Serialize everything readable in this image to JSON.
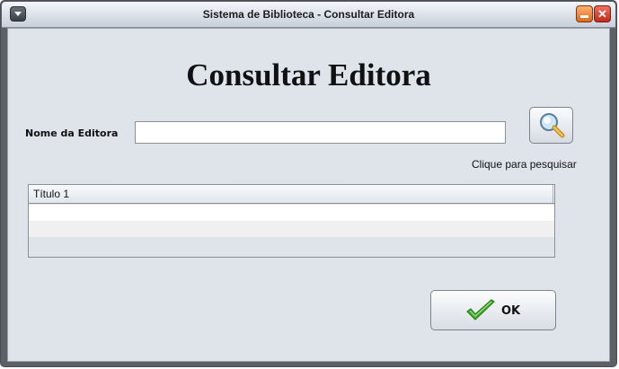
{
  "window": {
    "title": "Sistema de Biblioteca - Consultar Editora",
    "close_glyph": "✕"
  },
  "form": {
    "heading": "Consultar Editora",
    "name_label": "Nome da Editora",
    "name_value": "",
    "search_hint": "Clique para pesquisar"
  },
  "table": {
    "columns": [
      "Título 1"
    ],
    "rows": [
      [
        ""
      ],
      [
        ""
      ]
    ]
  },
  "buttons": {
    "ok_label": "OK",
    "ok_icon": "checkmark-icon",
    "search_icon": "magnifier-icon"
  },
  "colors": {
    "background": "#dfe3ea",
    "checkmark": "#3fae2a"
  }
}
